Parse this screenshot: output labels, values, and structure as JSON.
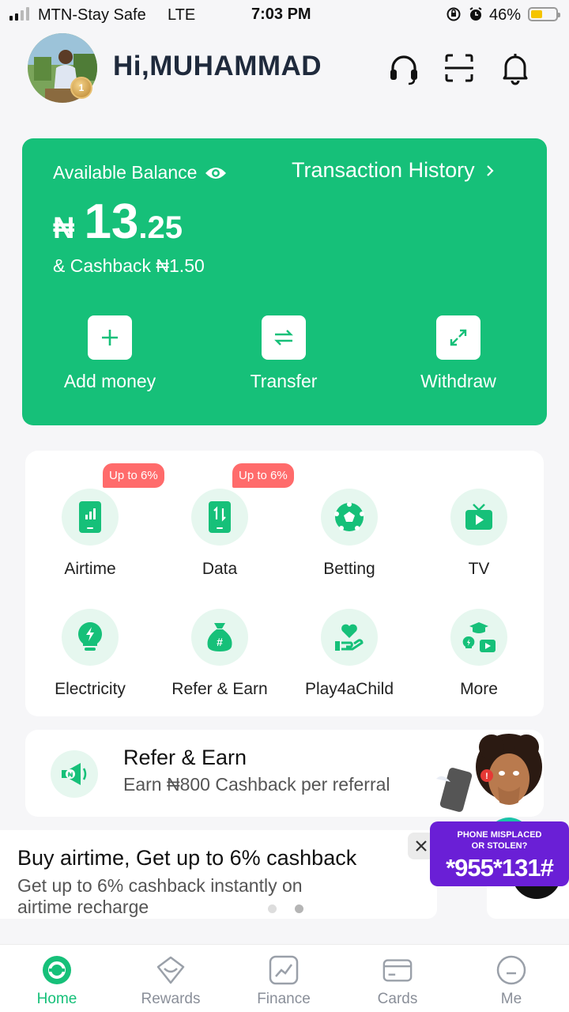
{
  "status_bar": {
    "carrier": "MTN-Stay Safe",
    "network": "LTE",
    "time": "7:03 PM",
    "battery_percent": "46%",
    "battery_level": 0.46
  },
  "header": {
    "greeting": "Hi,MUHAMMAD",
    "avatar_badge": "1",
    "icons": [
      "headset-icon",
      "scan-icon",
      "bell-icon"
    ]
  },
  "balance": {
    "label": "Available Balance",
    "transaction_history": "Transaction History",
    "currency": "₦",
    "amount_int": "13",
    "amount_dec": ".25",
    "cashback": "& Cashback ₦1.50",
    "actions": [
      {
        "label": "Add money",
        "icon": "plus-icon"
      },
      {
        "label": "Transfer",
        "icon": "transfer-arrows-icon"
      },
      {
        "label": "Withdraw",
        "icon": "withdraw-arrow-icon"
      }
    ]
  },
  "services": [
    {
      "label": "Airtime",
      "icon": "phone-signal-icon",
      "badge": "Up to 6%"
    },
    {
      "label": "Data",
      "icon": "phone-data-icon",
      "badge": "Up to 6%"
    },
    {
      "label": "Betting",
      "icon": "soccer-ball-icon"
    },
    {
      "label": "TV",
      "icon": "tv-icon"
    },
    {
      "label": "Electricity",
      "icon": "bulb-icon"
    },
    {
      "label": "Refer & Earn",
      "icon": "money-bag-icon"
    },
    {
      "label": "Play4aChild",
      "icon": "heart-hand-icon"
    },
    {
      "label": "More",
      "icon": "more-services-icon"
    }
  ],
  "refer_card": {
    "title": "Refer & Earn",
    "subtitle": "Earn ₦800 Cashback per referral"
  },
  "banner": {
    "title": "Buy airtime, Get up to 6% cashback",
    "text": "Get up to 6% cashback instantly on airtime recharge"
  },
  "float_ad": {
    "line1": "PHONE MISPLACED",
    "line2": "OR STOLEN?",
    "code": "*955*131#"
  },
  "bottom_nav": [
    {
      "label": "Home",
      "icon": "home-icon",
      "active": true
    },
    {
      "label": "Rewards",
      "icon": "rewards-icon"
    },
    {
      "label": "Finance",
      "icon": "finance-chart-icon"
    },
    {
      "label": "Cards",
      "icon": "card-icon"
    },
    {
      "label": "Me",
      "icon": "profile-icon"
    }
  ],
  "colors": {
    "brand_green": "#16c079",
    "badge_red": "#ff6b6b",
    "ad_purple": "#6a1fd6"
  }
}
